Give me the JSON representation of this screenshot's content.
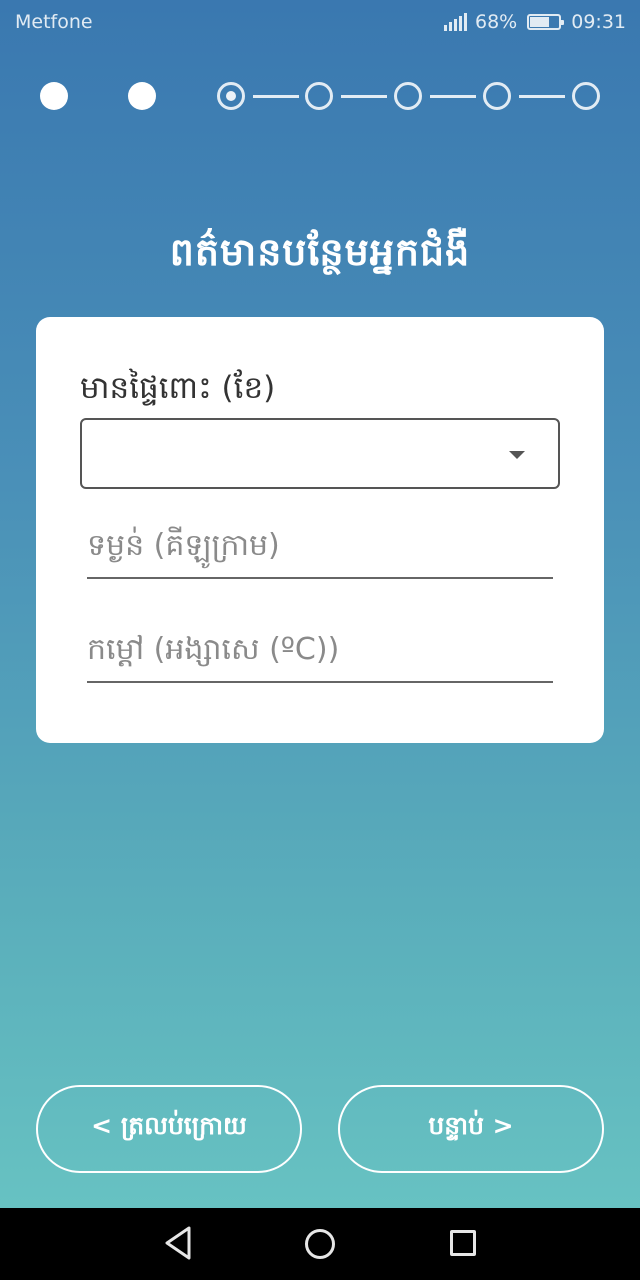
{
  "status_bar": {
    "carrier": "Metfone",
    "battery_percent": "68%",
    "battery_level": 0.68,
    "time": "09:31",
    "icons": [
      "signal-icon",
      "battery-icon"
    ]
  },
  "stepper": {
    "total_steps": 7,
    "completed_steps": 2,
    "current_step": 3
  },
  "page": {
    "title": "ពត៌មានបន្ថែមអ្នកជំងឺ"
  },
  "form": {
    "pregnancy_label": "មានផ្ទៃពោះ (ខែ)",
    "pregnancy_value": "",
    "weight_placeholder": "ទម្ងន់ (គីឡូក្រាម)",
    "weight_value": "",
    "temperature_placeholder": "កម្ដៅ (អង្សាសេ (ºC))",
    "temperature_value": ""
  },
  "buttons": {
    "back_label": "< ត្រលប់ក្រោយ",
    "next_label": "បន្ទាប់ >"
  },
  "nav_bar": {
    "icons": [
      "back-triangle-icon",
      "home-circle-icon",
      "recent-square-icon"
    ]
  }
}
